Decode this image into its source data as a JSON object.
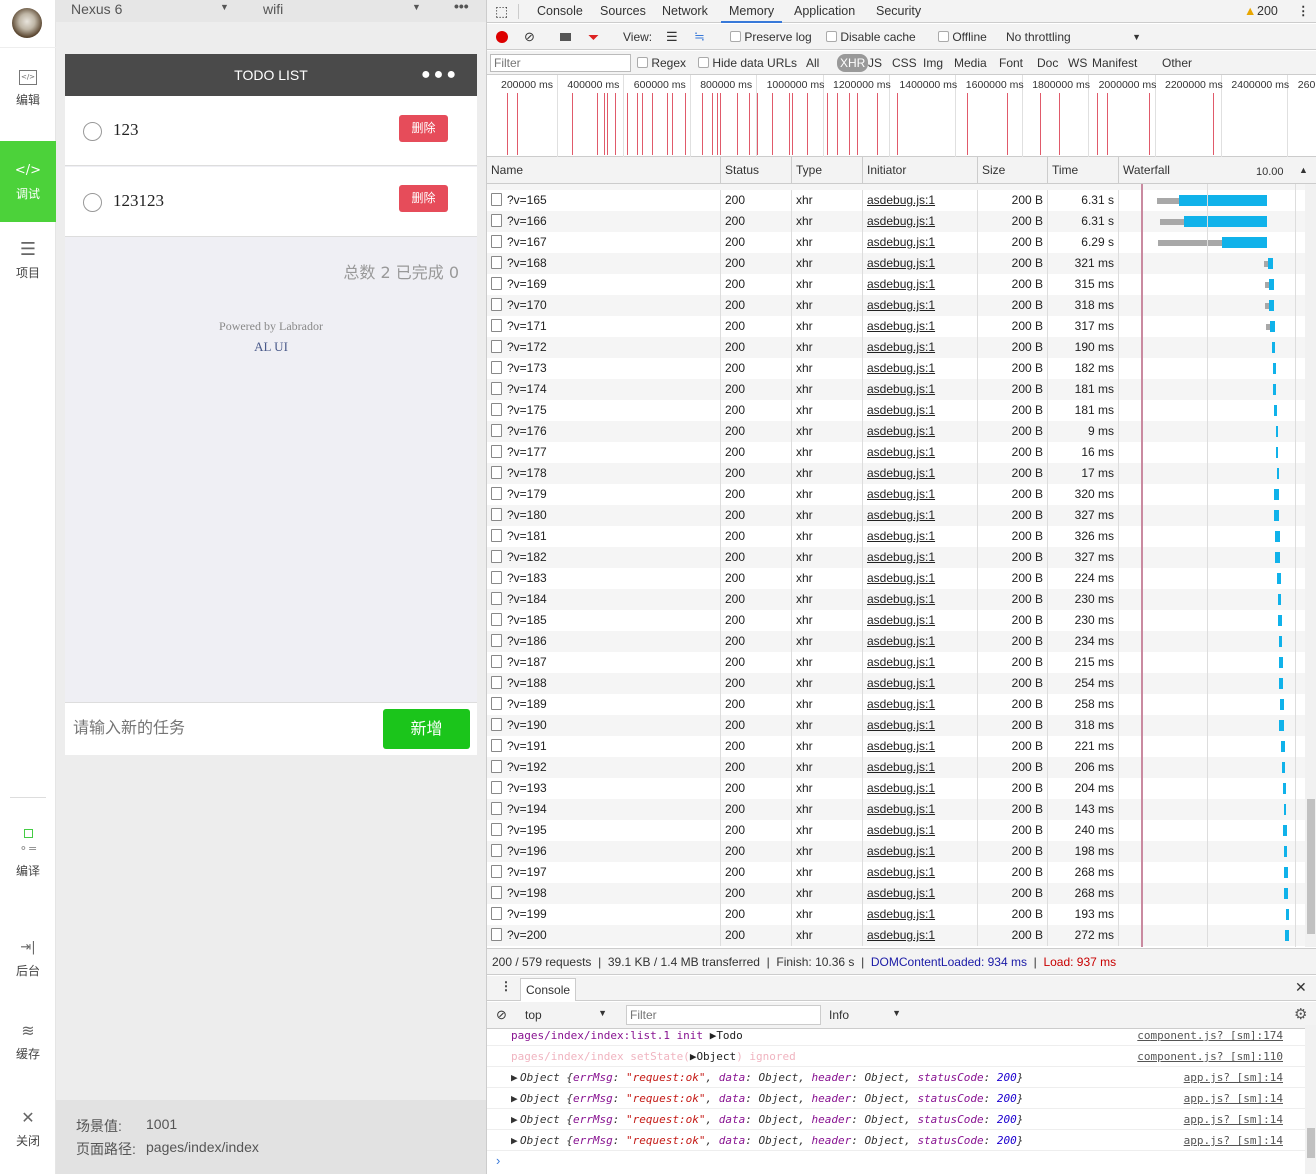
{
  "sidebar": {
    "items": [
      {
        "label": "编辑",
        "icon": "code-window-icon"
      },
      {
        "label": "调试",
        "icon": "code-icon",
        "active": true
      },
      {
        "label": "项目",
        "icon": "menu-icon"
      },
      {
        "label": "编译",
        "icon": "compile-icon"
      },
      {
        "label": "后台",
        "icon": "background-icon"
      },
      {
        "label": "缓存",
        "icon": "layers-icon"
      },
      {
        "label": "关闭",
        "icon": "close-icon"
      }
    ]
  },
  "simulator": {
    "device": "Nexus 6",
    "network": "wifi",
    "title": "TODO LIST",
    "todos": [
      {
        "text": "123",
        "delete_label": "删除"
      },
      {
        "text": "123123",
        "delete_label": "删除"
      }
    ],
    "summary": "总数 2 已完成 0",
    "powered_by": "Powered by Labrador",
    "powered_link": "AL UI",
    "input_placeholder": "请输入新的任务",
    "add_label": "新增",
    "scene_label": "场景值:",
    "scene_value": "1001",
    "path_label": "页面路径:",
    "path_value": "pages/index/index"
  },
  "devtools": {
    "tabs": [
      "Console",
      "Sources",
      "Network",
      "Memory",
      "Application",
      "Security"
    ],
    "selected_tab": "Memory",
    "warning_count": "200",
    "toolbar": {
      "view_label": "View:",
      "preserve_log": "Preserve log",
      "disable_cache": "Disable cache",
      "offline": "Offline",
      "throttling": "No throttling"
    },
    "filter": {
      "placeholder": "Filter",
      "regex": "Regex",
      "hide_data_urls": "Hide data URLs",
      "types": [
        "All",
        "XHR",
        "JS",
        "CSS",
        "Img",
        "Media",
        "Font",
        "Doc",
        "WS",
        "Manifest",
        "Other"
      ],
      "selected_type": "XHR"
    },
    "overview_ticks": [
      "200000 ms",
      "400000 ms",
      "600000 ms",
      "800000 ms",
      "1000000 ms",
      "1200000 ms",
      "1400000 ms",
      "1600000 ms",
      "1800000 ms",
      "2000000 ms",
      "2200000 ms",
      "2400000 ms",
      "260"
    ],
    "columns": [
      "Name",
      "Status",
      "Type",
      "Initiator",
      "Size",
      "Time",
      "Waterfall"
    ],
    "waterfall_scale": "10.00",
    "requests": [
      [
        "?v=165",
        "200",
        "xhr",
        "asdebug.js:1",
        "200 B",
        "6.31 s"
      ],
      [
        "?v=166",
        "200",
        "xhr",
        "asdebug.js:1",
        "200 B",
        "6.31 s"
      ],
      [
        "?v=167",
        "200",
        "xhr",
        "asdebug.js:1",
        "200 B",
        "6.29 s"
      ],
      [
        "?v=168",
        "200",
        "xhr",
        "asdebug.js:1",
        "200 B",
        "321 ms"
      ],
      [
        "?v=169",
        "200",
        "xhr",
        "asdebug.js:1",
        "200 B",
        "315 ms"
      ],
      [
        "?v=170",
        "200",
        "xhr",
        "asdebug.js:1",
        "200 B",
        "318 ms"
      ],
      [
        "?v=171",
        "200",
        "xhr",
        "asdebug.js:1",
        "200 B",
        "317 ms"
      ],
      [
        "?v=172",
        "200",
        "xhr",
        "asdebug.js:1",
        "200 B",
        "190 ms"
      ],
      [
        "?v=173",
        "200",
        "xhr",
        "asdebug.js:1",
        "200 B",
        "182 ms"
      ],
      [
        "?v=174",
        "200",
        "xhr",
        "asdebug.js:1",
        "200 B",
        "181 ms"
      ],
      [
        "?v=175",
        "200",
        "xhr",
        "asdebug.js:1",
        "200 B",
        "181 ms"
      ],
      [
        "?v=176",
        "200",
        "xhr",
        "asdebug.js:1",
        "200 B",
        "9 ms"
      ],
      [
        "?v=177",
        "200",
        "xhr",
        "asdebug.js:1",
        "200 B",
        "16 ms"
      ],
      [
        "?v=178",
        "200",
        "xhr",
        "asdebug.js:1",
        "200 B",
        "17 ms"
      ],
      [
        "?v=179",
        "200",
        "xhr",
        "asdebug.js:1",
        "200 B",
        "320 ms"
      ],
      [
        "?v=180",
        "200",
        "xhr",
        "asdebug.js:1",
        "200 B",
        "327 ms"
      ],
      [
        "?v=181",
        "200",
        "xhr",
        "asdebug.js:1",
        "200 B",
        "326 ms"
      ],
      [
        "?v=182",
        "200",
        "xhr",
        "asdebug.js:1",
        "200 B",
        "327 ms"
      ],
      [
        "?v=183",
        "200",
        "xhr",
        "asdebug.js:1",
        "200 B",
        "224 ms"
      ],
      [
        "?v=184",
        "200",
        "xhr",
        "asdebug.js:1",
        "200 B",
        "230 ms"
      ],
      [
        "?v=185",
        "200",
        "xhr",
        "asdebug.js:1",
        "200 B",
        "230 ms"
      ],
      [
        "?v=186",
        "200",
        "xhr",
        "asdebug.js:1",
        "200 B",
        "234 ms"
      ],
      [
        "?v=187",
        "200",
        "xhr",
        "asdebug.js:1",
        "200 B",
        "215 ms"
      ],
      [
        "?v=188",
        "200",
        "xhr",
        "asdebug.js:1",
        "200 B",
        "254 ms"
      ],
      [
        "?v=189",
        "200",
        "xhr",
        "asdebug.js:1",
        "200 B",
        "258 ms"
      ],
      [
        "?v=190",
        "200",
        "xhr",
        "asdebug.js:1",
        "200 B",
        "318 ms"
      ],
      [
        "?v=191",
        "200",
        "xhr",
        "asdebug.js:1",
        "200 B",
        "221 ms"
      ],
      [
        "?v=192",
        "200",
        "xhr",
        "asdebug.js:1",
        "200 B",
        "206 ms"
      ],
      [
        "?v=193",
        "200",
        "xhr",
        "asdebug.js:1",
        "200 B",
        "204 ms"
      ],
      [
        "?v=194",
        "200",
        "xhr",
        "asdebug.js:1",
        "200 B",
        "143 ms"
      ],
      [
        "?v=195",
        "200",
        "xhr",
        "asdebug.js:1",
        "200 B",
        "240 ms"
      ],
      [
        "?v=196",
        "200",
        "xhr",
        "asdebug.js:1",
        "200 B",
        "198 ms"
      ],
      [
        "?v=197",
        "200",
        "xhr",
        "asdebug.js:1",
        "200 B",
        "268 ms"
      ],
      [
        "?v=198",
        "200",
        "xhr",
        "asdebug.js:1",
        "200 B",
        "268 ms"
      ],
      [
        "?v=199",
        "200",
        "xhr",
        "asdebug.js:1",
        "200 B",
        "193 ms"
      ],
      [
        "?v=200",
        "200",
        "xhr",
        "asdebug.js:1",
        "200 B",
        "272 ms"
      ]
    ],
    "status_bar": {
      "requests": "200 / 579 requests",
      "transferred": "39.1 KB / 1.4 MB transferred",
      "finish": "Finish: 10.36 s",
      "dcl": "DOMContentLoaded: 934 ms",
      "load": "Load: 937 ms"
    },
    "console": {
      "tab": "Console",
      "context": "top",
      "filter_placeholder": "Filter",
      "level": "Info",
      "messages": [
        {
          "text": "pages/index/index:list.1 init ",
          "obj": "Todo",
          "source": "component.js? [sm]:174"
        },
        {
          "text": "pages/index/index setState(",
          "obj": "Object",
          "after": ") ignored",
          "source": "component.js? [sm]:110"
        },
        {
          "text": "Object {errMsg: \"request:ok\", data: Object, header: Object, statusCode: 200}",
          "source": "app.js? [sm]:14"
        },
        {
          "text": "Object {errMsg: \"request:ok\", data: Object, header: Object, statusCode: 200}",
          "source": "app.js? [sm]:14"
        },
        {
          "text": "Object {errMsg: \"request:ok\", data: Object, header: Object, statusCode: 200}",
          "source": "app.js? [sm]:14"
        },
        {
          "text": "Object {errMsg: \"request:ok\", data: Object, header: Object, statusCode: 200}",
          "source": "app.js? [sm]:14"
        }
      ],
      "prompt": "›"
    },
    "colors": {
      "dcl": "#1a1aa6",
      "load": "#c80000",
      "waterfall_bar": "#10b2ea",
      "waiting": "#a8a8a8",
      "active_sidebar": "#4cd23a"
    }
  }
}
